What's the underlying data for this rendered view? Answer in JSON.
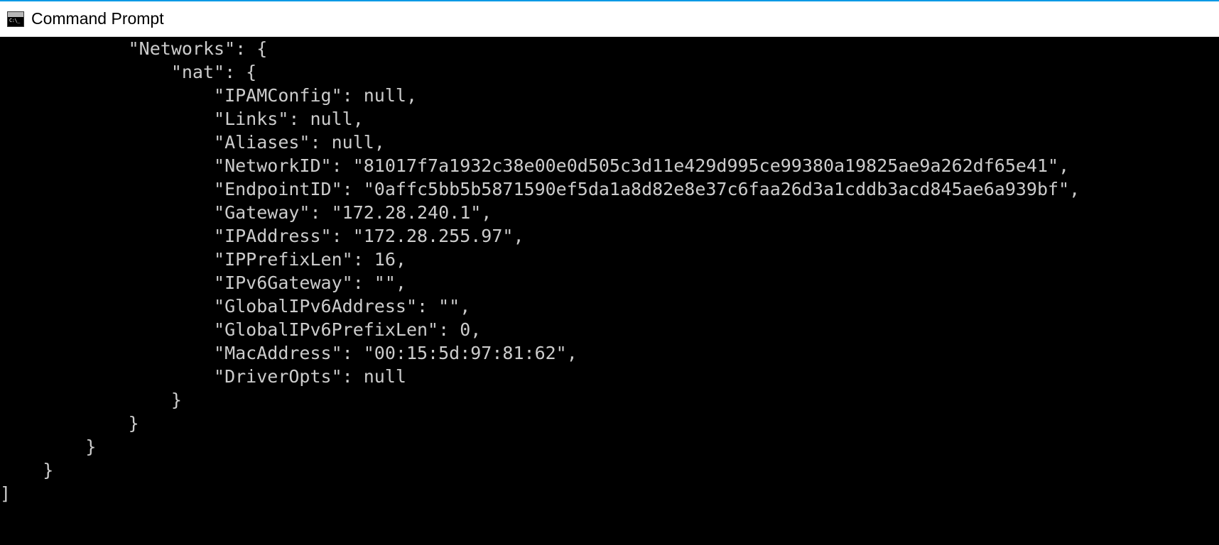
{
  "window": {
    "title": "Command Prompt"
  },
  "terminal": {
    "lines": [
      "            \"Networks\": {",
      "                \"nat\": {",
      "                    \"IPAMConfig\": null,",
      "                    \"Links\": null,",
      "                    \"Aliases\": null,",
      "                    \"NetworkID\": \"81017f7a1932c38e00e0d505c3d11e429d995ce99380a19825ae9a262df65e41\",",
      "                    \"EndpointID\": \"0affc5bb5b5871590ef5da1a8d82e8e37c6faa26d3a1cddb3acd845ae6a939bf\",",
      "                    \"Gateway\": \"172.28.240.1\",",
      "                    \"IPAddress\": \"172.28.255.97\",",
      "                    \"IPPrefixLen\": 16,",
      "                    \"IPv6Gateway\": \"\",",
      "                    \"GlobalIPv6Address\": \"\",",
      "                    \"GlobalIPv6PrefixLen\": 0,",
      "                    \"MacAddress\": \"00:15:5d:97:81:62\",",
      "                    \"DriverOpts\": null",
      "                }",
      "            }",
      "        }",
      "    }",
      "]"
    ]
  }
}
